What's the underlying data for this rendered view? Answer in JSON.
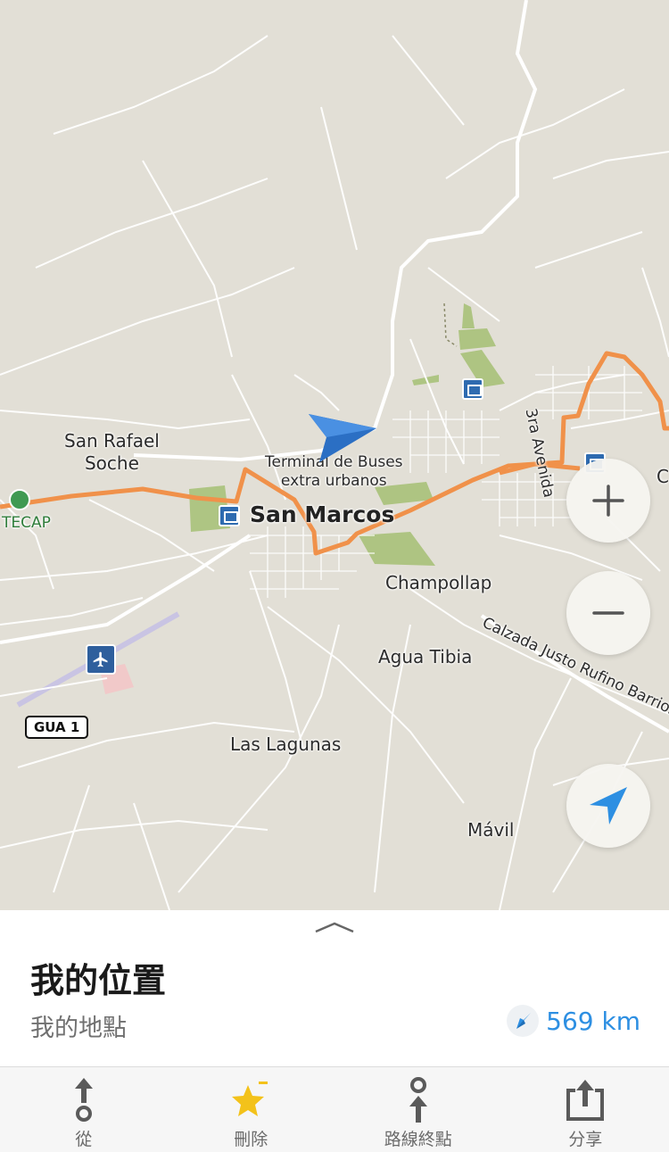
{
  "map": {
    "labels": {
      "city": "San Marcos",
      "san_rafael": "San Rafael\nSoche",
      "terminal": "Terminal de Buses\nextra urbanos",
      "champollap": "Champollap",
      "agua_tibia": "Agua Tibia",
      "las_lagunas": "Las Lagunas",
      "mavil": "Mávil",
      "tecap": "TECAP",
      "calzada": "Calzada Justo Rufino Barrios",
      "avenida": "3ra Avenida",
      "edge_c": "C",
      "route_shield": "GUA 1"
    },
    "icons": [
      "bus-station-icon",
      "airport-icon",
      "park-icon",
      "position-arrow-icon"
    ],
    "colors": {
      "background": "#e2dfd6",
      "roads": "#ffffff",
      "route": "#f0914a",
      "parks": "#a9c27a",
      "accent": "#2d8fe2"
    }
  },
  "controls": {
    "zoom_in": "zoom-in",
    "zoom_out": "zoom-out",
    "locate": "locate-me"
  },
  "sheet": {
    "title": "我的位置",
    "subtitle": "我的地點",
    "distance": "569 km"
  },
  "tabbar": {
    "tabs": [
      {
        "label": "從",
        "icon": "route-from-icon"
      },
      {
        "label": "刪除",
        "icon": "bookmark-star-icon"
      },
      {
        "label": "路線終點",
        "icon": "route-to-icon"
      },
      {
        "label": "分享",
        "icon": "share-icon"
      }
    ]
  }
}
